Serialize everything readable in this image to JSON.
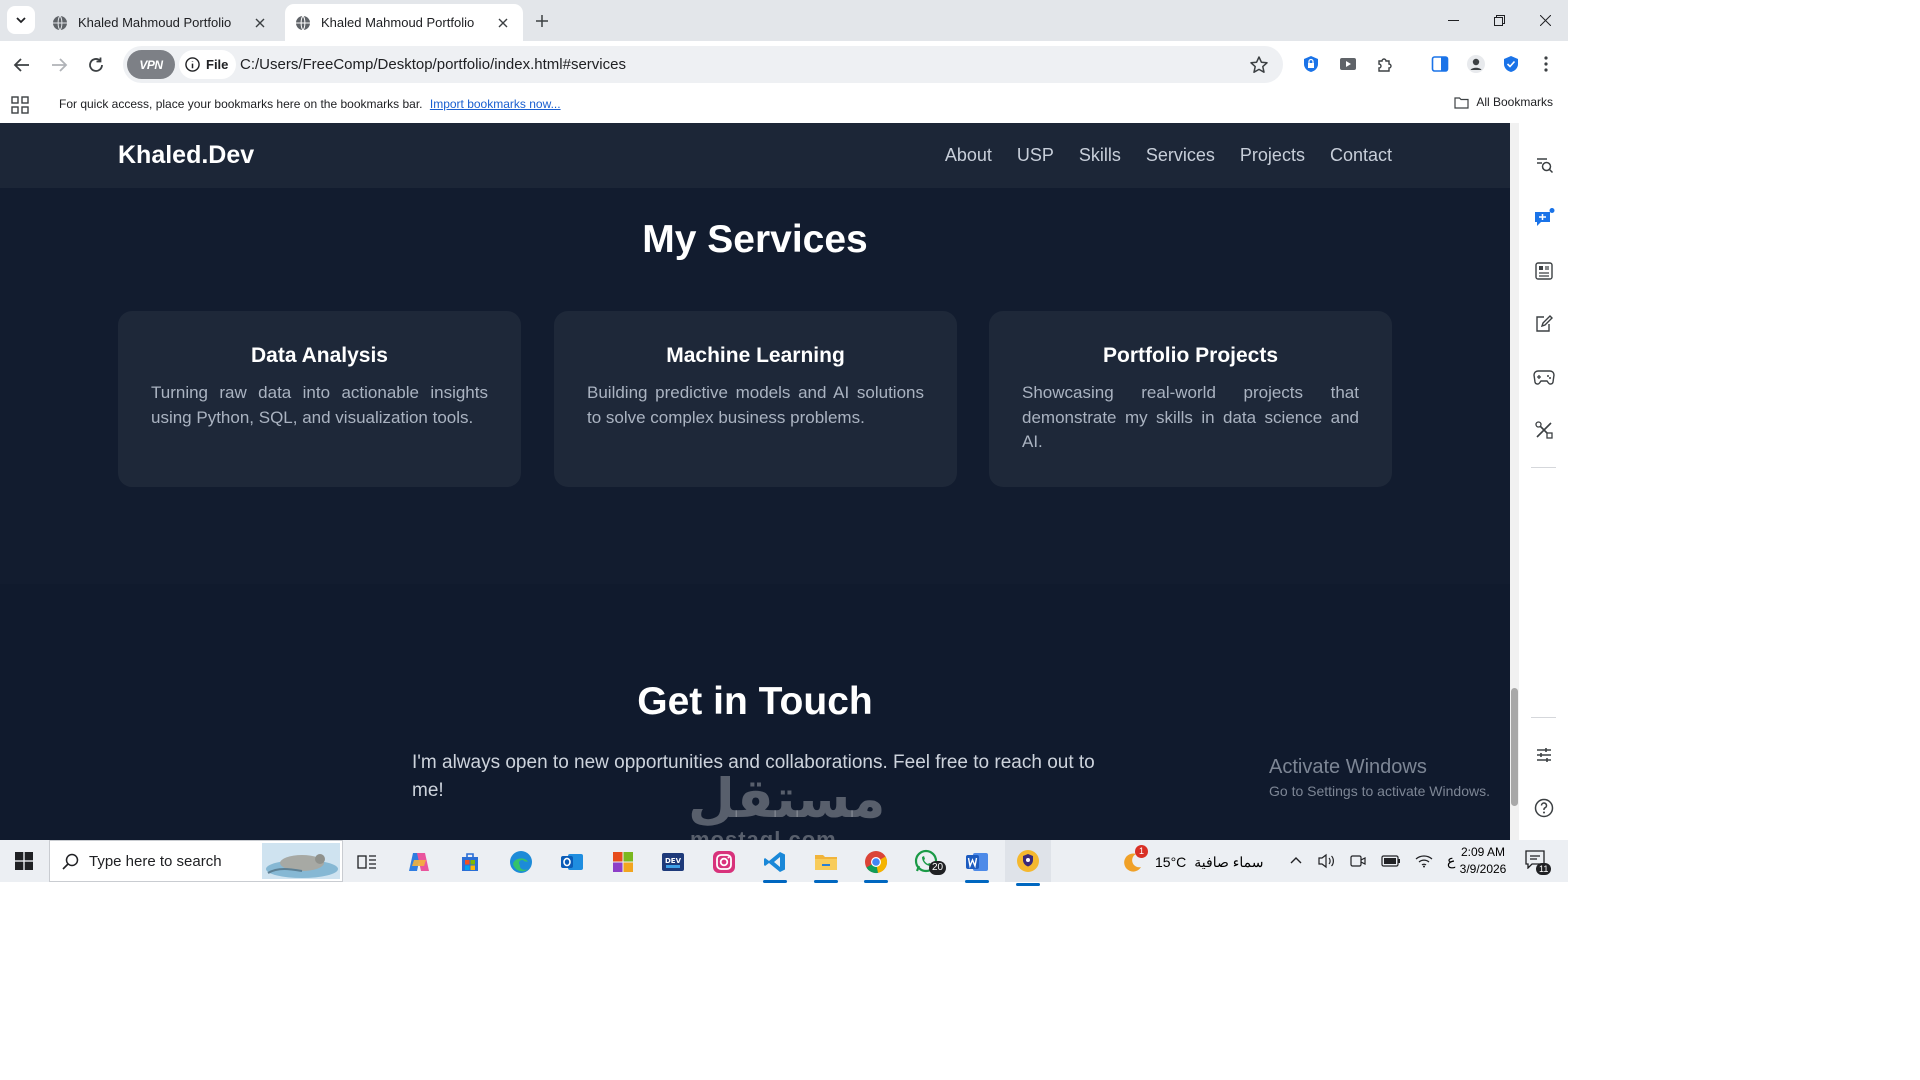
{
  "browser": {
    "tabs": [
      {
        "title": "Khaled Mahmoud Portfolio",
        "active": false
      },
      {
        "title": "Khaled Mahmoud Portfolio",
        "active": true
      }
    ],
    "vpn_label": "VPN",
    "site_chip_label": "File",
    "url": "C:/Users/FreeComp/Desktop/portfolio/index.html#services",
    "bookmarks_message": "For quick access, place your bookmarks here on the bookmarks bar.",
    "bookmarks_link": "Import bookmarks now...",
    "all_bookmarks": "All Bookmarks"
  },
  "site": {
    "logo": "Khaled.Dev",
    "nav": [
      "About",
      "USP",
      "Skills",
      "Services",
      "Projects",
      "Contact"
    ],
    "services_title": "My Services",
    "services": [
      {
        "title": "Data Analysis",
        "text": "Turning raw data into actionable insights using Python, SQL, and visualization tools."
      },
      {
        "title": "Machine Learning",
        "text": "Building predictive models and AI solutions to solve complex business problems."
      },
      {
        "title": "Portfolio Projects",
        "text": "Showcasing real-world projects that demonstrate my skills in data science and AI."
      }
    ],
    "contact_title": "Get in Touch",
    "contact_text": "I'm always open to new opportunities and collaborations. Feel free to reach out to me!"
  },
  "overlay": {
    "activate_title": "Activate Windows",
    "activate_sub": "Go to Settings to activate Windows.",
    "watermark_ar": "مستقل",
    "watermark_en": "mostaql.com"
  },
  "taskbar": {
    "search_placeholder": "Type here to search",
    "weather_temp": "15°C",
    "weather_desc": "سماء صافية",
    "weather_badge": "1",
    "language": "ع",
    "time": "2:09 AM",
    "date": "3/9/2026",
    "whatsapp_badge": "20",
    "notifications_badge": "11",
    "apps": [
      "task-view",
      "copilot",
      "microsoft-store",
      "edge",
      "outlook",
      "office",
      "devtoys",
      "instagram",
      "vscode",
      "file-explorer",
      "chrome",
      "whatsapp",
      "word",
      "vpn-app"
    ]
  },
  "colors": {
    "page_bg": "#101a2d",
    "nav_bg": "#1c2637",
    "card_bg": "#1e2839",
    "link_blue": "#1a5fd0",
    "taskbar_accent": "#0067c0"
  }
}
